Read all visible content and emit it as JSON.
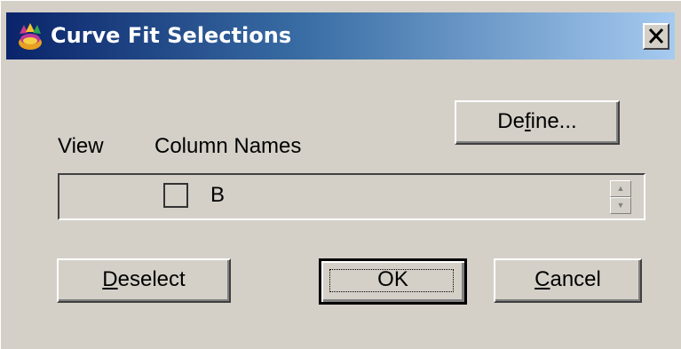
{
  "window": {
    "title": "Curve Fit Selections",
    "icon": "app-logo-icon",
    "close_label": "X"
  },
  "labels": {
    "view": "View",
    "column_names": "Column Names"
  },
  "buttons": {
    "define": {
      "pre": "De",
      "ul": "f",
      "post": "ine..."
    },
    "deselect": {
      "pre": "",
      "ul": "D",
      "post": "eselect"
    },
    "ok": {
      "label": "OK"
    },
    "cancel": {
      "pre": "",
      "ul": "C",
      "post": "ancel"
    }
  },
  "columns": [
    {
      "name": "B",
      "checked": false
    }
  ],
  "colors": {
    "title_gradient_start": "#0a246a",
    "title_gradient_end": "#a6caf0",
    "dialog_bg": "#d4d0c8"
  }
}
